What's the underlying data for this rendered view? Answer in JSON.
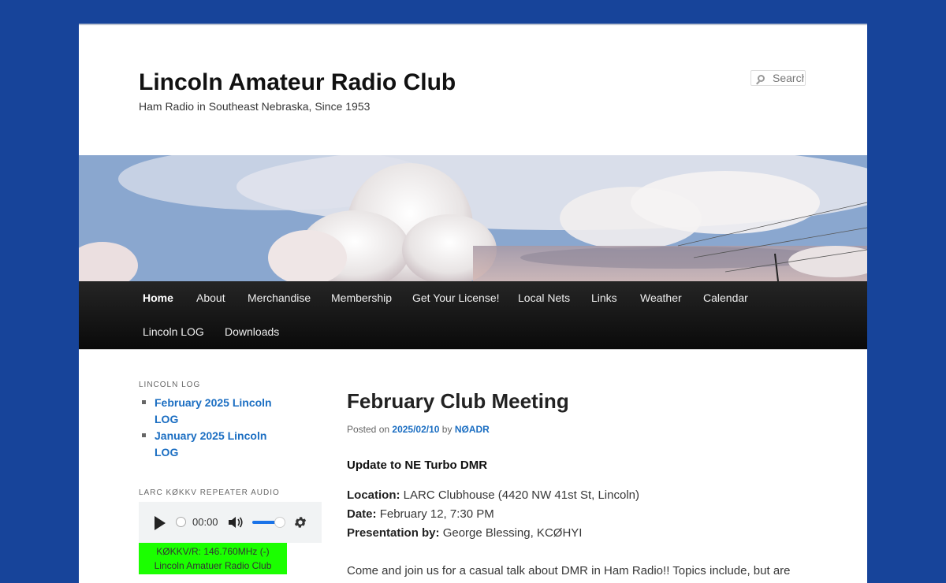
{
  "header": {
    "site_title": "Lincoln Amateur Radio Club",
    "site_description": "Ham Radio in Southeast Nebraska, Since 1953",
    "search_placeholder": "Search"
  },
  "nav": {
    "items": [
      {
        "label": "Home",
        "current": true
      },
      {
        "label": "About"
      },
      {
        "label": "Merchandise"
      },
      {
        "label": "Membership"
      },
      {
        "label": "Get Your License!"
      },
      {
        "label": "Local Nets"
      },
      {
        "label": "Links"
      },
      {
        "label": "Weather"
      },
      {
        "label": "Calendar"
      },
      {
        "label": "Lincoln LOG"
      },
      {
        "label": "Downloads"
      }
    ]
  },
  "sidebar": {
    "log_widget_title": "LINCOLN LOG",
    "log_items": [
      {
        "label": "February 2025 Lincoln LOG"
      },
      {
        "label": "January 2025 Lincoln LOG"
      }
    ],
    "audio_widget_title": "LARC KØKKV REPEATER AUDIO",
    "audio_time": "00:00",
    "repeater_line1": "KØKKV/R: 146.760MHz (-)",
    "repeater_line2": "Lincoln Amatuer Radio Club"
  },
  "post": {
    "title": "February Club Meeting",
    "posted_on_label": "Posted on",
    "date": "2025/02/10",
    "by_label": "by",
    "author": "NØADR",
    "subhead": "Update to NE Turbo DMR",
    "location_label": "Location:",
    "location_value": "LARC Clubhouse (4420 NW 41st St, Lincoln)",
    "date_label": "Date:",
    "date_value": "February 12, 7:30 PM",
    "presentation_label": "Presentation by:",
    "presentation_value": "George Blessing, KCØHYI",
    "intro": "Come and join us for a casual talk about DMR in Ham Radio!! Topics include, but are"
  },
  "colors": {
    "background": "#17449a",
    "link": "#1b6ec2",
    "repeater_box": "#1bff00",
    "nav_bar": "#111111"
  }
}
